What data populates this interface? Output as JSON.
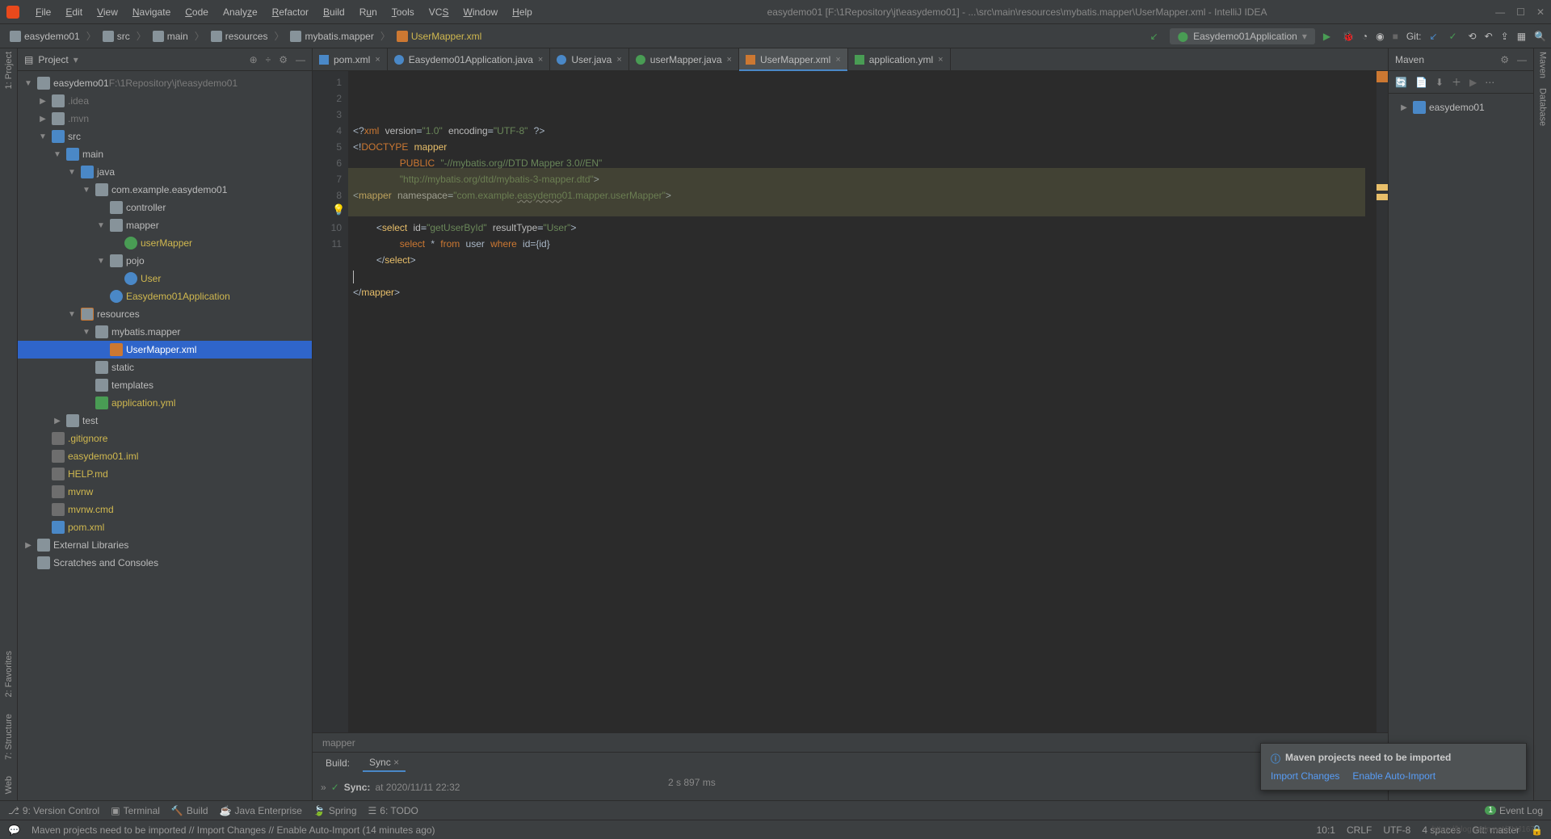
{
  "title": "easydemo01 [F:\\1Repository\\jt\\easydemo01] - ...\\src\\main\\resources\\mybatis.mapper\\UserMapper.xml - IntelliJ IDEA",
  "menu": [
    "File",
    "Edit",
    "View",
    "Navigate",
    "Code",
    "Analyze",
    "Refactor",
    "Build",
    "Run",
    "Tools",
    "VCS",
    "Window",
    "Help"
  ],
  "breadcrumb": [
    "easydemo01",
    "src",
    "main",
    "resources",
    "mybatis.mapper",
    "UserMapper.xml"
  ],
  "runConfig": "Easydemo01Application",
  "gitLabel": "Git:",
  "leftGutter": [
    "1: Project",
    "2: Favorites",
    "7: Structure",
    "Web"
  ],
  "projectHeader": "Project",
  "tree": [
    {
      "d": 0,
      "a": "▼",
      "i": "folder",
      "t": "easydemo01",
      "suf": "  F:\\1Repository\\jt\\easydemo01",
      "sufClass": "dim"
    },
    {
      "d": 1,
      "a": "▶",
      "i": "folder",
      "t": ".idea",
      "cls": "dim"
    },
    {
      "d": 1,
      "a": "▶",
      "i": "folder",
      "t": ".mvn",
      "cls": "dim"
    },
    {
      "d": 1,
      "a": "▼",
      "i": "folder-blue",
      "t": "src"
    },
    {
      "d": 2,
      "a": "▼",
      "i": "folder-blue",
      "t": "main"
    },
    {
      "d": 3,
      "a": "▼",
      "i": "folder-blue",
      "t": "java"
    },
    {
      "d": 4,
      "a": "▼",
      "i": "folder",
      "t": "com.example.easydemo01"
    },
    {
      "d": 5,
      "a": "",
      "i": "folder",
      "t": "controller"
    },
    {
      "d": 5,
      "a": "▼",
      "i": "folder",
      "t": "mapper"
    },
    {
      "d": 6,
      "a": "",
      "i": "java-i",
      "t": "userMapper",
      "cls": "yellow"
    },
    {
      "d": 5,
      "a": "▼",
      "i": "folder",
      "t": "pojo"
    },
    {
      "d": 6,
      "a": "",
      "i": "java-c",
      "t": "User",
      "cls": "yellow"
    },
    {
      "d": 5,
      "a": "",
      "i": "java-c",
      "t": "Easydemo01Application",
      "cls": "yellow"
    },
    {
      "d": 3,
      "a": "▼",
      "i": "folder-res",
      "t": "resources"
    },
    {
      "d": 4,
      "a": "▼",
      "i": "folder",
      "t": "mybatis.mapper"
    },
    {
      "d": 5,
      "a": "",
      "i": "xml",
      "t": "UserMapper.xml",
      "sel": true
    },
    {
      "d": 4,
      "a": "",
      "i": "folder",
      "t": "static"
    },
    {
      "d": 4,
      "a": "",
      "i": "folder",
      "t": "templates"
    },
    {
      "d": 4,
      "a": "",
      "i": "yml",
      "t": "application.yml",
      "cls": "yellow"
    },
    {
      "d": 2,
      "a": "▶",
      "i": "folder",
      "t": "test"
    },
    {
      "d": 1,
      "a": "",
      "i": "file",
      "t": ".gitignore",
      "cls": "yellow"
    },
    {
      "d": 1,
      "a": "",
      "i": "file",
      "t": "easydemo01.iml",
      "cls": "yellow"
    },
    {
      "d": 1,
      "a": "",
      "i": "file",
      "t": "HELP.md",
      "cls": "yellow"
    },
    {
      "d": 1,
      "a": "",
      "i": "file",
      "t": "mvnw",
      "cls": "yellow"
    },
    {
      "d": 1,
      "a": "",
      "i": "file",
      "t": "mvnw.cmd",
      "cls": "yellow"
    },
    {
      "d": 1,
      "a": "",
      "i": "maven",
      "t": "pom.xml",
      "cls": "yellow"
    },
    {
      "d": 0,
      "a": "▶",
      "i": "folder",
      "t": "External Libraries"
    },
    {
      "d": 0,
      "a": "",
      "i": "folder",
      "t": "Scratches and Consoles"
    }
  ],
  "tabs": [
    {
      "icon": "maven",
      "label": "pom.xml"
    },
    {
      "icon": "java-c",
      "label": "Easydemo01Application.java"
    },
    {
      "icon": "java-c",
      "label": "User.java"
    },
    {
      "icon": "java-i",
      "label": "userMapper.java"
    },
    {
      "icon": "xml",
      "label": "UserMapper.xml",
      "active": true
    },
    {
      "icon": "yml",
      "label": "application.yml"
    }
  ],
  "codeLines": 11,
  "crumbBar": "mapper",
  "mavenHeader": "Maven",
  "mavenProject": "easydemo01",
  "rightGutter": [
    "Maven",
    "Database"
  ],
  "build": {
    "tabs": [
      "Build:",
      "Sync"
    ],
    "syncLabel": "Sync:",
    "syncTime": "at 2020/11/11 22:32",
    "duration": "2 s 897 ms"
  },
  "bottomTabs": [
    "9: Version Control",
    "Terminal",
    "Build",
    "Java Enterprise",
    "Spring",
    "6: TODO"
  ],
  "eventLog": "Event Log",
  "statusMsg": "Maven projects need to be imported // Import Changes // Enable Auto-Import (14 minutes ago)",
  "statusRight": [
    "10:1",
    "CRLF",
    "UTF-8",
    "4 spaces",
    "Git: master"
  ],
  "notif": {
    "title": "Maven projects need to be imported",
    "link1": "Import Changes",
    "link2": "Enable Auto-Import"
  },
  "watermark": "https://blog.csdn.net/ZHJ167"
}
